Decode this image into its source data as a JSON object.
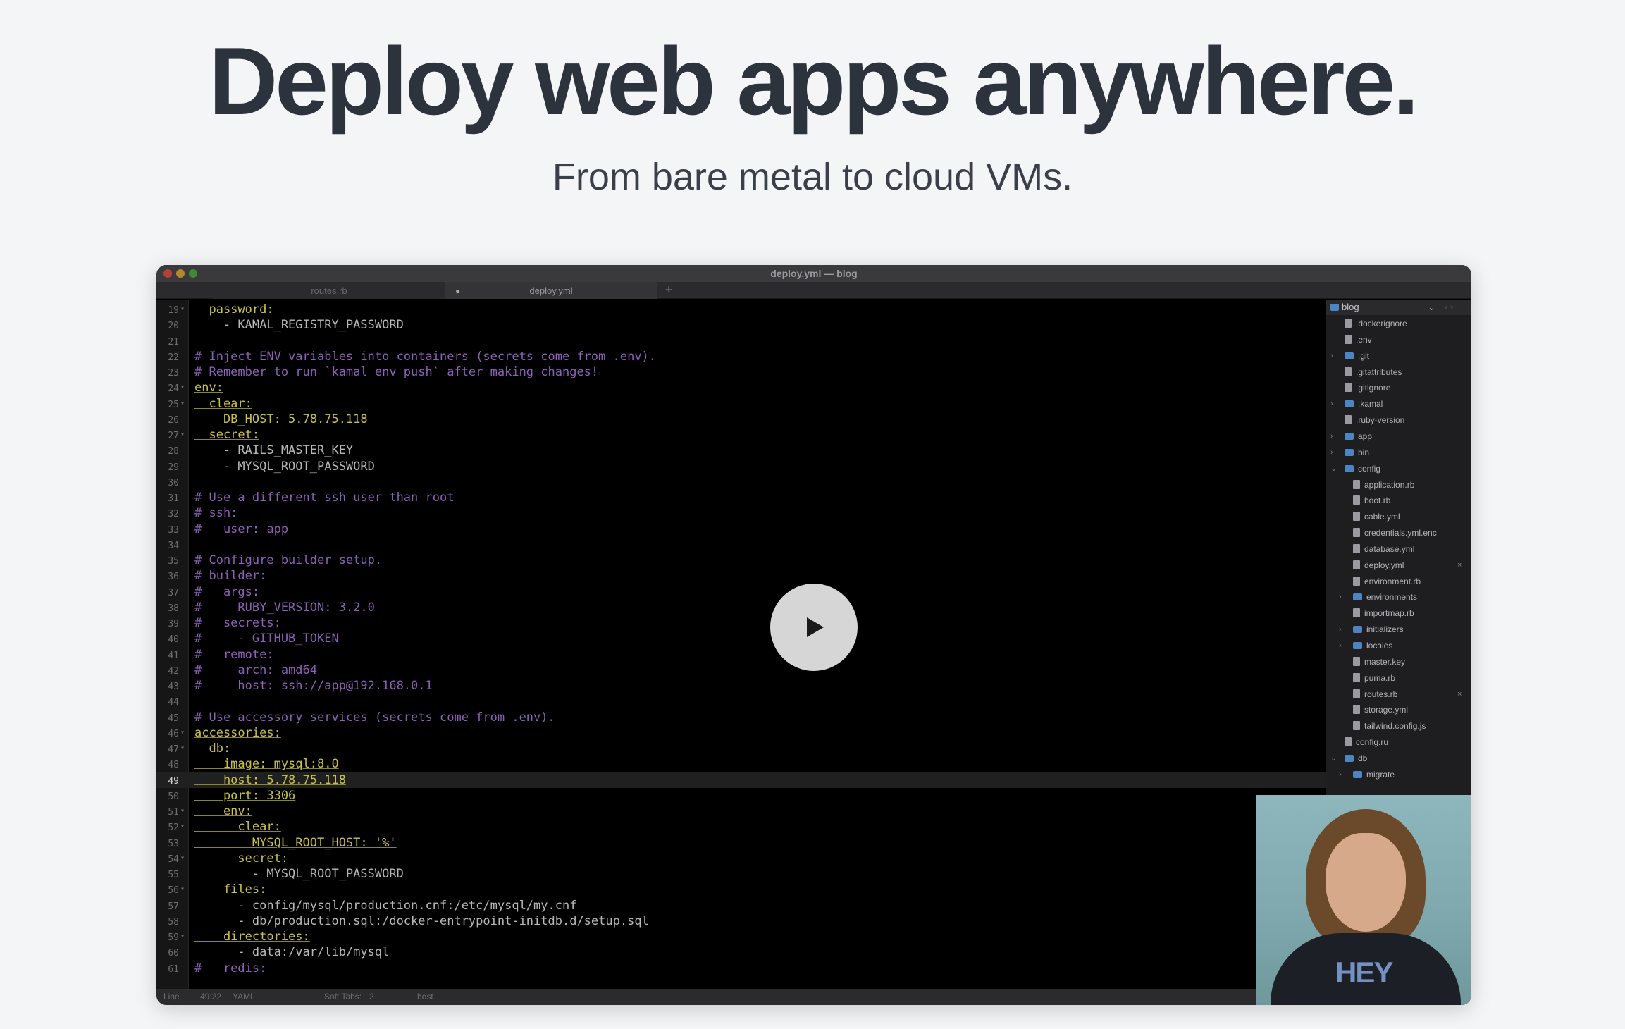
{
  "hero": {
    "title": "Deploy web apps anywhere.",
    "subtitle": "From bare metal to cloud VMs."
  },
  "video": {
    "window_title": "deploy.yml — blog",
    "tabs": [
      {
        "label": "routes.rb"
      },
      {
        "label": "deploy.yml"
      }
    ],
    "tab_modified_marker": "●",
    "tab_add": "+",
    "current_line": "49",
    "code_lines": [
      {
        "n": "19",
        "fold": true,
        "text": "  password:"
      },
      {
        "n": "20",
        "fold": false,
        "text": "    - KAMAL_REGISTRY_PASSWORD"
      },
      {
        "n": "21",
        "fold": false,
        "text": ""
      },
      {
        "n": "22",
        "fold": false,
        "text": "# Inject ENV variables into containers (secrets come from .env)."
      },
      {
        "n": "23",
        "fold": false,
        "text": "# Remember to run `kamal env push` after making changes!"
      },
      {
        "n": "24",
        "fold": true,
        "text": "env:"
      },
      {
        "n": "25",
        "fold": true,
        "text": "  clear:"
      },
      {
        "n": "26",
        "fold": false,
        "text": "    DB_HOST: 5.78.75.118"
      },
      {
        "n": "27",
        "fold": true,
        "text": "  secret:"
      },
      {
        "n": "28",
        "fold": false,
        "text": "    - RAILS_MASTER_KEY"
      },
      {
        "n": "29",
        "fold": false,
        "text": "    - MYSQL_ROOT_PASSWORD"
      },
      {
        "n": "30",
        "fold": false,
        "text": ""
      },
      {
        "n": "31",
        "fold": false,
        "text": "# Use a different ssh user than root"
      },
      {
        "n": "32",
        "fold": false,
        "text": "# ssh:"
      },
      {
        "n": "33",
        "fold": false,
        "text": "#   user: app"
      },
      {
        "n": "34",
        "fold": false,
        "text": ""
      },
      {
        "n": "35",
        "fold": false,
        "text": "# Configure builder setup."
      },
      {
        "n": "36",
        "fold": false,
        "text": "# builder:"
      },
      {
        "n": "37",
        "fold": false,
        "text": "#   args:"
      },
      {
        "n": "38",
        "fold": false,
        "text": "#     RUBY_VERSION: 3.2.0"
      },
      {
        "n": "39",
        "fold": false,
        "text": "#   secrets:"
      },
      {
        "n": "40",
        "fold": false,
        "text": "#     - GITHUB_TOKEN"
      },
      {
        "n": "41",
        "fold": false,
        "text": "#   remote:"
      },
      {
        "n": "42",
        "fold": false,
        "text": "#     arch: amd64"
      },
      {
        "n": "43",
        "fold": false,
        "text": "#     host: ssh://app@192.168.0.1"
      },
      {
        "n": "44",
        "fold": false,
        "text": ""
      },
      {
        "n": "45",
        "fold": false,
        "text": "# Use accessory services (secrets come from .env)."
      },
      {
        "n": "46",
        "fold": true,
        "text": "accessories:"
      },
      {
        "n": "47",
        "fold": true,
        "text": "  db:"
      },
      {
        "n": "48",
        "fold": false,
        "text": "    image: mysql:8.0"
      },
      {
        "n": "49",
        "fold": false,
        "text": "    host: 5.78.75.118"
      },
      {
        "n": "50",
        "fold": false,
        "text": "    port: 3306"
      },
      {
        "n": "51",
        "fold": true,
        "text": "    env:"
      },
      {
        "n": "52",
        "fold": true,
        "text": "      clear:"
      },
      {
        "n": "53",
        "fold": false,
        "text": "        MYSQL_ROOT_HOST: '%'"
      },
      {
        "n": "54",
        "fold": true,
        "text": "      secret:"
      },
      {
        "n": "55",
        "fold": false,
        "text": "        - MYSQL_ROOT_PASSWORD"
      },
      {
        "n": "56",
        "fold": true,
        "text": "    files:"
      },
      {
        "n": "57",
        "fold": false,
        "text": "      - config/mysql/production.cnf:/etc/mysql/my.cnf"
      },
      {
        "n": "58",
        "fold": false,
        "text": "      - db/production.sql:/docker-entrypoint-initdb.d/setup.sql"
      },
      {
        "n": "59",
        "fold": true,
        "text": "    directories:"
      },
      {
        "n": "60",
        "fold": false,
        "text": "      - data:/var/lib/mysql"
      },
      {
        "n": "61",
        "fold": false,
        "text": "#   redis:"
      }
    ],
    "sidebar": {
      "root": "blog",
      "root_chevron": "⌄",
      "nav": "‹ ›",
      "items": [
        {
          "label": ".dockerignore",
          "type": "file",
          "level": 1,
          "arrow": ""
        },
        {
          "label": ".env",
          "type": "file",
          "level": 1,
          "arrow": ""
        },
        {
          "label": ".git",
          "type": "folder",
          "level": 1,
          "arrow": "›"
        },
        {
          "label": ".gitattributes",
          "type": "file",
          "level": 1,
          "arrow": ""
        },
        {
          "label": ".gitignore",
          "type": "file",
          "level": 1,
          "arrow": ""
        },
        {
          "label": ".kamal",
          "type": "folder",
          "level": 1,
          "arrow": "›"
        },
        {
          "label": ".ruby-version",
          "type": "file",
          "level": 1,
          "arrow": ""
        },
        {
          "label": "app",
          "type": "folder",
          "level": 1,
          "arrow": "›"
        },
        {
          "label": "bin",
          "type": "folder",
          "level": 1,
          "arrow": "›"
        },
        {
          "label": "config",
          "type": "folder",
          "level": 1,
          "arrow": "⌄"
        },
        {
          "label": "application.rb",
          "type": "file",
          "level": 2,
          "arrow": ""
        },
        {
          "label": "boot.rb",
          "type": "file",
          "level": 2,
          "arrow": ""
        },
        {
          "label": "cable.yml",
          "type": "file",
          "level": 2,
          "arrow": ""
        },
        {
          "label": "credentials.yml.enc",
          "type": "file",
          "level": 2,
          "arrow": ""
        },
        {
          "label": "database.yml",
          "type": "file",
          "level": 2,
          "arrow": ""
        },
        {
          "label": "deploy.yml",
          "type": "file",
          "level": 2,
          "arrow": "",
          "close": "×"
        },
        {
          "label": "environment.rb",
          "type": "file",
          "level": 2,
          "arrow": ""
        },
        {
          "label": "environments",
          "type": "folder",
          "level": 2,
          "arrow": "›"
        },
        {
          "label": "importmap.rb",
          "type": "file",
          "level": 2,
          "arrow": ""
        },
        {
          "label": "initializers",
          "type": "folder",
          "level": 2,
          "arrow": "›"
        },
        {
          "label": "locales",
          "type": "folder",
          "level": 2,
          "arrow": "›"
        },
        {
          "label": "master.key",
          "type": "file",
          "level": 2,
          "arrow": ""
        },
        {
          "label": "puma.rb",
          "type": "file",
          "level": 2,
          "arrow": ""
        },
        {
          "label": "routes.rb",
          "type": "file",
          "level": 2,
          "arrow": "",
          "close": "×"
        },
        {
          "label": "storage.yml",
          "type": "file",
          "level": 2,
          "arrow": ""
        },
        {
          "label": "tailwind.config.js",
          "type": "file",
          "level": 2,
          "arrow": ""
        },
        {
          "label": "config.ru",
          "type": "file",
          "level": 1,
          "arrow": ""
        },
        {
          "label": "db",
          "type": "folder",
          "level": 1,
          "arrow": "⌄"
        },
        {
          "label": "migrate",
          "type": "folder",
          "level": 2,
          "arrow": "›"
        }
      ]
    },
    "statusbar": {
      "line_label": "Line",
      "position": "49:22",
      "language": "YAML",
      "tabs": "Soft Tabs:",
      "tab_size": "2",
      "symbol": "host"
    },
    "webcam_shirt_text": "HEY"
  }
}
